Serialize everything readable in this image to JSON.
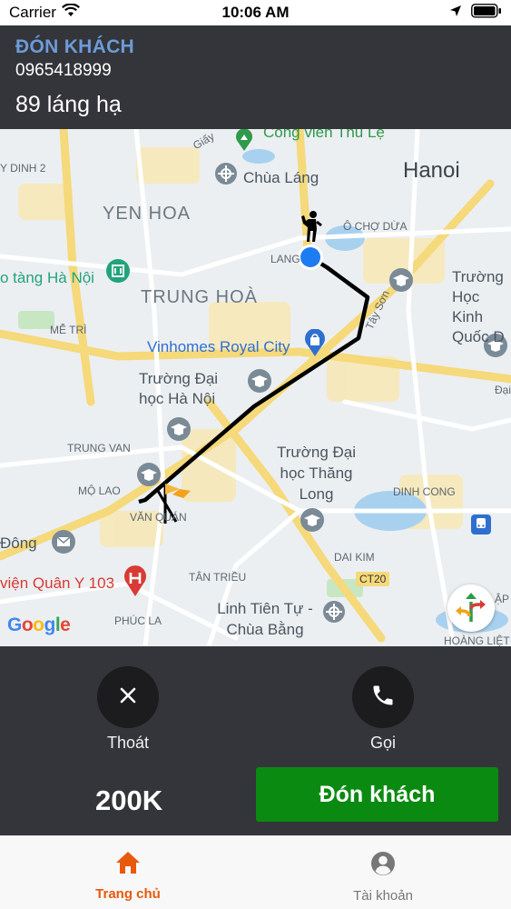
{
  "status_bar": {
    "carrier": "Carrier",
    "time": "10:06 AM"
  },
  "header": {
    "title": "ĐÓN KHÁCH",
    "phone": "0965418999",
    "address": "89 láng hạ"
  },
  "map": {
    "labels": {
      "cong_vien": "Công viên Thủ Lệ",
      "giay": "Giấy",
      "dinh2": "Y DINH 2",
      "chua_lang": "Chùa Láng",
      "hanoi": "Hanoi",
      "yen_hoa": "YEN HOA",
      "o_cho_dua": "Ô CHỢ DỪA",
      "lang": "LANG",
      "bao_tang": "o tàng Hà Nội",
      "trung_hoa": "TRUNG HOÀ",
      "truong_hoc_kinh": "Trường Học Kinh Quốc D",
      "me_tri": "MỄ TRÌ",
      "vinhomes": "Vinhomes Royal City",
      "tay_son": "Tây Sơn",
      "dh_hanoi": "Trường Đại học Hà Nội",
      "trung_van": "TRUNG VAN",
      "dh_thang_long": "Trường Đại học Thăng Long",
      "mo_lao": "MỘ LAO",
      "van_quan": "VĂN QUÁN",
      "dinh_cong": "DINH CONG",
      "dong": "Đông",
      "dai_kim": "DAI KIM",
      "ct20": "CT20",
      "quan_y": "viện Quân Y 103",
      "tan_trieu": "TÂN TRIỀU",
      "linh_tien": "Linh Tiên Tự - Chùa Bằng",
      "phuc_la": "PHÚC LA",
      "hoang_liet": "HOÀNG LIỆT",
      "dai": "Đại",
      "ap": "ẬP",
      "google": "Google"
    }
  },
  "actions": {
    "exit_label": "Thoát",
    "call_label": "Gọi",
    "price": "200K",
    "pickup_label": "Đón khách"
  },
  "tabs": [
    {
      "label": "Trang chủ",
      "active": true
    },
    {
      "label": "Tài khoản",
      "active": false
    }
  ],
  "colors": {
    "accent": "#e8590c",
    "header_bg": "#34353a",
    "pickup_green": "#0b8a12",
    "title_blue": "#6d9bd9"
  }
}
